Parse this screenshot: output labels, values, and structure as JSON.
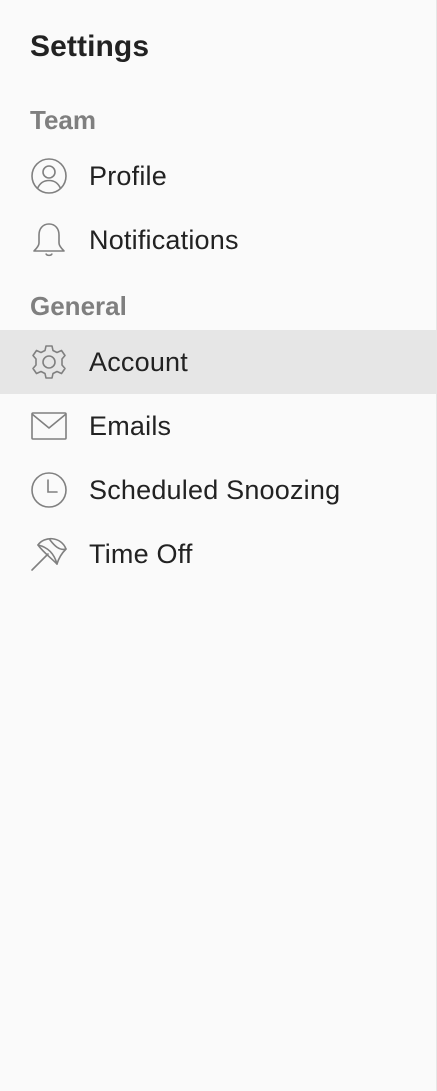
{
  "header": {
    "title": "Settings"
  },
  "sections": [
    {
      "label": "Team",
      "items": [
        {
          "label": "Profile",
          "icon": "profile-icon",
          "active": false
        },
        {
          "label": "Notifications",
          "icon": "bell-icon",
          "active": false
        }
      ]
    },
    {
      "label": "General",
      "items": [
        {
          "label": "Account",
          "icon": "gear-icon",
          "active": true
        },
        {
          "label": "Emails",
          "icon": "envelope-icon",
          "active": false
        },
        {
          "label": "Scheduled Snoozing",
          "icon": "clock-icon",
          "active": false
        },
        {
          "label": "Time Off",
          "icon": "beach-umbrella-icon",
          "active": false
        }
      ]
    }
  ],
  "colors": {
    "background": "#fafafa",
    "active_item_bg": "#e6e6e6",
    "section_label": "#7f7f7f",
    "text": "#222222",
    "icon_stroke": "#808080"
  }
}
